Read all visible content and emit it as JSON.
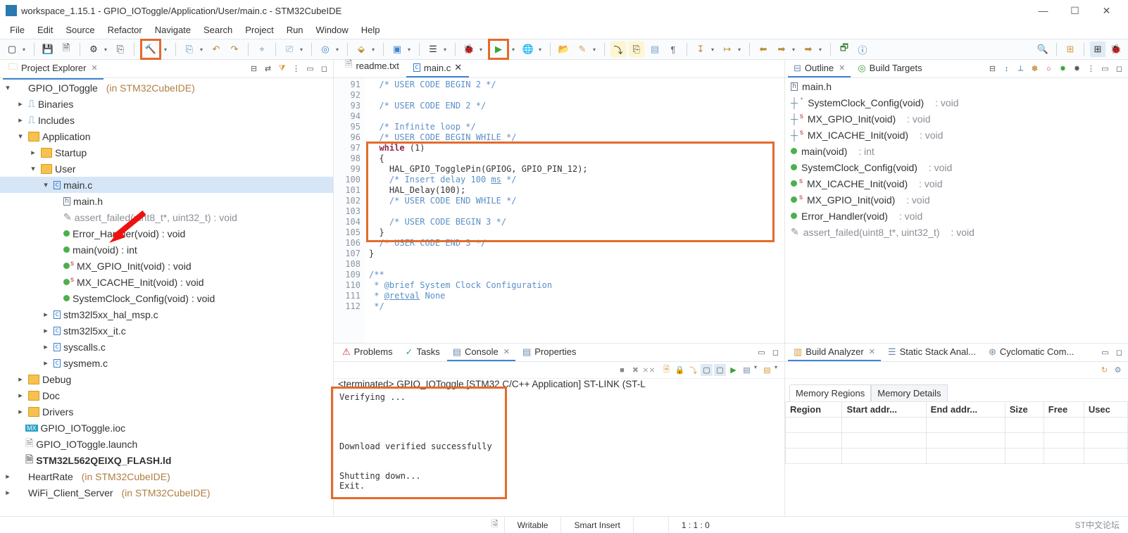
{
  "window": {
    "title": "workspace_1.15.1 - GPIO_IOToggle/Application/User/main.c - STM32CubeIDE"
  },
  "menu": [
    "File",
    "Edit",
    "Source",
    "Refactor",
    "Navigate",
    "Search",
    "Project",
    "Run",
    "Window",
    "Help"
  ],
  "explorer": {
    "title": "Project Explorer",
    "project": "GPIO_IOToggle",
    "project_suffix": "(in STM32CubeIDE)",
    "binaries": "Binaries",
    "includes": "Includes",
    "application": "Application",
    "startup": "Startup",
    "user": "User",
    "main_c": "main.c",
    "main_h": "main.h",
    "assert_failed": "assert_failed(uint8_t*, uint32_t) : void",
    "error_handler": "Error_Handler(void) : void",
    "main_void": "main(void) : int",
    "mx_gpio": "MX_GPIO_Init(void) : void",
    "mx_icache": "MX_ICACHE_Init(void) : void",
    "sysclock": "SystemClock_Config(void) : void",
    "hal_msp": "stm32l5xx_hal_msp.c",
    "it_c": "stm32l5xx_it.c",
    "syscalls": "syscalls.c",
    "sysmem": "sysmem.c",
    "debug": "Debug",
    "doc": "Doc",
    "drivers": "Drivers",
    "ioc": "GPIO_IOToggle.ioc",
    "launch": "GPIO_IOToggle.launch",
    "flash": "STM32L562QEIXQ_FLASH.ld",
    "heartrate": "HeartRate",
    "heartrate_suffix": "(in STM32CubeIDE)",
    "wifi": "WiFi_Client_Server",
    "wifi_suffix": "(in STM32CubeIDE)"
  },
  "editor": {
    "tab1": "readme.txt",
    "tab2": "main.c",
    "gutter": [
      "91",
      "92",
      "93",
      "94",
      "95",
      "96",
      "97",
      "98",
      "99",
      "100",
      "101",
      "102",
      "103",
      "104",
      "105",
      "106",
      "107",
      "108",
      "109",
      "110",
      "111",
      "112"
    ]
  },
  "outline": {
    "title": "Outline",
    "build_targets": "Build Targets",
    "main_h": "main.h",
    "sysclock": "SystemClock_Config(void)",
    "mx_gpio": "MX_GPIO_Init(void)",
    "mx_icache": "MX_ICACHE_Init(void)",
    "main": "main(void)",
    "sysclock2": "SystemClock_Config(void)",
    "mx_icache2": "MX_ICACHE_Init(void)",
    "mx_gpio2": "MX_GPIO_Init(void)",
    "error_handler": "Error_Handler(void)",
    "assert_failed": "assert_failed(uint8_t*, uint32_t)",
    "ret_void": ": void",
    "ret_int": ": int"
  },
  "bottom": {
    "problems": "Problems",
    "tasks": "Tasks",
    "console": "Console",
    "properties": "Properties",
    "console_title": "<terminated> GPIO_IOToggle [STM32 C/C++ Application] ST-LINK (ST-L",
    "console_text": "Verifying ...\n\n\n\n\nDownload verified successfully\n\n\nShutting down...\nExit."
  },
  "analyzer": {
    "build": "Build Analyzer",
    "stack": "Static Stack Anal...",
    "cyclo": "Cyclomatic Com...",
    "tab1": "Memory Regions",
    "tab2": "Memory Details",
    "cols": [
      "Region",
      "Start addr...",
      "End addr...",
      "Size",
      "Free",
      "Usec"
    ]
  },
  "status": {
    "writable": "Writable",
    "insert": "Smart Insert",
    "pos": "1 : 1 : 0",
    "watermark": "ST中文论坛"
  }
}
